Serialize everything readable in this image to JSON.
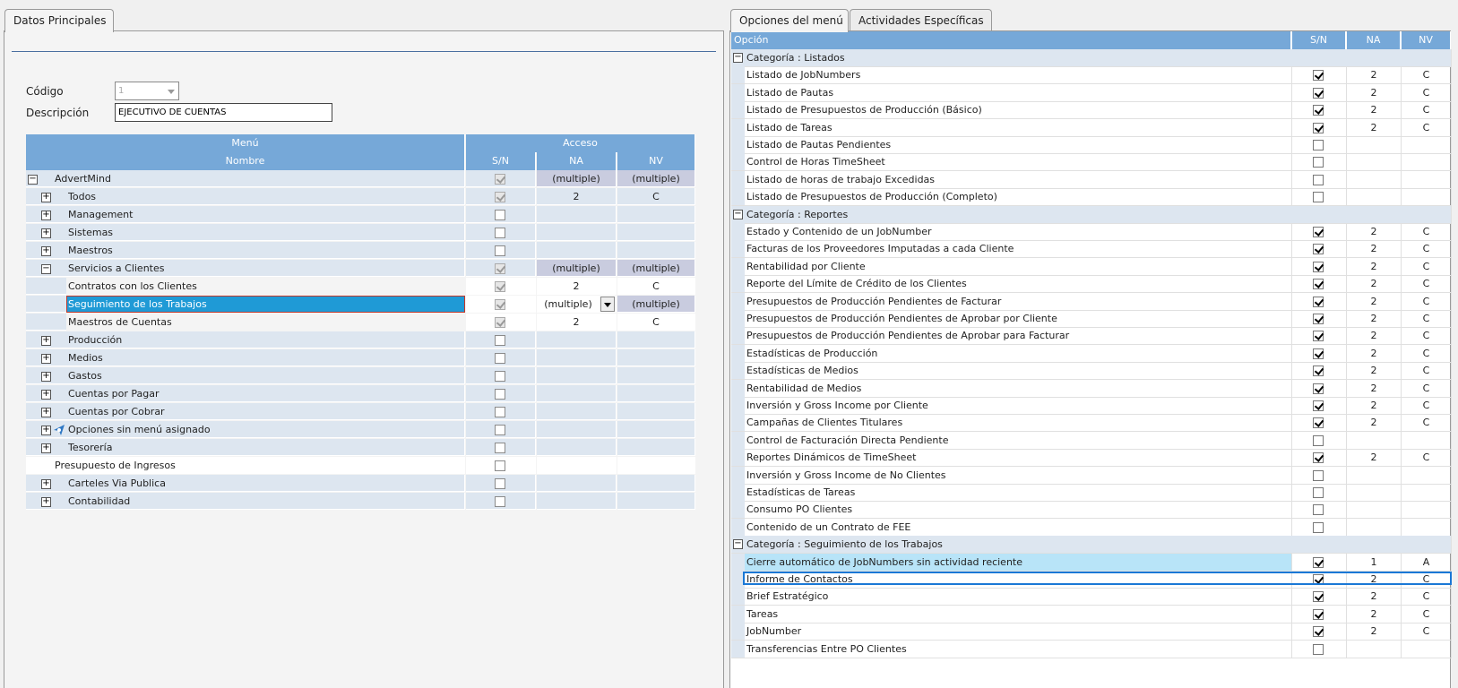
{
  "left_tabs": [
    {
      "label": "Datos Principales"
    }
  ],
  "right_tabs": [
    {
      "label": "Opciones del menú"
    },
    {
      "label": "Actividades Específicas"
    }
  ],
  "form": {
    "codigo_label": "Código",
    "codigo_value": "1",
    "descripcion_label": "Descripción",
    "descripcion_value": "EJECUTIVO DE CUENTAS"
  },
  "menu_grid": {
    "header_menu": "Menú",
    "header_acceso": "Acceso",
    "col_nombre": "Nombre",
    "col_sn": "S/N",
    "col_na": "NA",
    "col_nv": "NV",
    "rows": [
      {
        "name": "AdvertMind",
        "level": 0,
        "exp": "−",
        "sn": "disabled",
        "na": "(multiple)",
        "nv": "(multiple)"
      },
      {
        "name": "Todos",
        "level": 1,
        "exp": "+",
        "sn": "disabled",
        "na": "2",
        "nv": "C"
      },
      {
        "name": "Management",
        "level": 1,
        "exp": "+",
        "sn": "empty",
        "na": "",
        "nv": ""
      },
      {
        "name": "Sistemas",
        "level": 1,
        "exp": "+",
        "sn": "empty",
        "na": "",
        "nv": ""
      },
      {
        "name": "Maestros",
        "level": 1,
        "exp": "+",
        "sn": "empty",
        "na": "",
        "nv": ""
      },
      {
        "name": "Servicios a Clientes",
        "level": 1,
        "exp": "−",
        "sn": "disabled",
        "na": "(multiple)",
        "nv": "(multiple)"
      },
      {
        "name": "Contratos con los Clientes",
        "level": 2,
        "exp": "",
        "sn": "disabled",
        "na": "2",
        "nv": "C"
      },
      {
        "name": "Seguimiento de los Trabajos",
        "level": 2,
        "exp": "",
        "sn": "disabled",
        "na": "(multiple)",
        "nv": "(multiple)",
        "selected": true
      },
      {
        "name": "Maestros de Cuentas",
        "level": 2,
        "exp": "",
        "sn": "disabled",
        "na": "2",
        "nv": "C"
      },
      {
        "name": "Producción",
        "level": 1,
        "exp": "+",
        "sn": "empty",
        "na": "",
        "nv": ""
      },
      {
        "name": "Medios",
        "level": 1,
        "exp": "+",
        "sn": "empty",
        "na": "",
        "nv": ""
      },
      {
        "name": "Gastos",
        "level": 1,
        "exp": "+",
        "sn": "empty",
        "na": "",
        "nv": ""
      },
      {
        "name": "Cuentas por Pagar",
        "level": 1,
        "exp": "+",
        "sn": "empty",
        "na": "",
        "nv": ""
      },
      {
        "name": "Cuentas por Cobrar",
        "level": 1,
        "exp": "+",
        "sn": "empty",
        "na": "",
        "nv": ""
      },
      {
        "name": "Opciones sin menú asignado",
        "level": 1,
        "exp": "+",
        "sn": "empty",
        "na": "",
        "nv": "",
        "icon": "pin-icon"
      },
      {
        "name": "Tesorería",
        "level": 1,
        "exp": "+",
        "sn": "empty",
        "na": "",
        "nv": ""
      },
      {
        "name": "Presupuesto de Ingresos",
        "level": 0,
        "exp": "",
        "sn": "empty",
        "na": "",
        "nv": "",
        "white": true
      },
      {
        "name": "Carteles Via Publica",
        "level": 1,
        "exp": "+",
        "sn": "empty",
        "na": "",
        "nv": ""
      },
      {
        "name": "Contabilidad",
        "level": 1,
        "exp": "+",
        "sn": "empty",
        "na": "",
        "nv": ""
      }
    ]
  },
  "options_grid": {
    "col_opcion": "Opción",
    "col_sn": "S/N",
    "col_na": "NA",
    "col_nv": "NV",
    "rows": [
      {
        "cat": true,
        "name": "Categoría : Listados"
      },
      {
        "name": "Listado de JobNumbers",
        "sn": true,
        "na": "2",
        "nv": "C"
      },
      {
        "name": "Listado de Pautas",
        "sn": true,
        "na": "2",
        "nv": "C"
      },
      {
        "name": "Listado de Presupuestos de Producción (Básico)",
        "sn": true,
        "na": "2",
        "nv": "C"
      },
      {
        "name": "Listado de Tareas",
        "sn": true,
        "na": "2",
        "nv": "C"
      },
      {
        "name": "Listado de Pautas Pendientes",
        "sn": false,
        "na": "",
        "nv": ""
      },
      {
        "name": "Control de Horas TimeSheet",
        "sn": false,
        "na": "",
        "nv": ""
      },
      {
        "name": "Listado de horas de trabajo Excedidas",
        "sn": false,
        "na": "",
        "nv": ""
      },
      {
        "name": "Listado de Presupuestos de Producción (Completo)",
        "sn": false,
        "na": "",
        "nv": ""
      },
      {
        "cat": true,
        "name": "Categoría : Reportes"
      },
      {
        "name": "Estado y Contenido de un JobNumber",
        "sn": true,
        "na": "2",
        "nv": "C"
      },
      {
        "name": "Facturas de los Proveedores Imputadas a cada Cliente",
        "sn": true,
        "na": "2",
        "nv": "C"
      },
      {
        "name": "Rentabilidad por Cliente",
        "sn": true,
        "na": "2",
        "nv": "C"
      },
      {
        "name": "Reporte del Límite de Crédito de los Clientes",
        "sn": true,
        "na": "2",
        "nv": "C"
      },
      {
        "name": "Presupuestos de Producción Pendientes de Facturar",
        "sn": true,
        "na": "2",
        "nv": "C"
      },
      {
        "name": "Presupuestos de Producción Pendientes de Aprobar por Cliente",
        "sn": true,
        "na": "2",
        "nv": "C"
      },
      {
        "name": "Presupuestos de Producción Pendientes de Aprobar para Facturar",
        "sn": true,
        "na": "2",
        "nv": "C"
      },
      {
        "name": "Estadísticas de Producción",
        "sn": true,
        "na": "2",
        "nv": "C"
      },
      {
        "name": "Estadísticas de Medios",
        "sn": true,
        "na": "2",
        "nv": "C"
      },
      {
        "name": "Rentabilidad de Medios",
        "sn": true,
        "na": "2",
        "nv": "C"
      },
      {
        "name": "Inversión y Gross Income por Cliente",
        "sn": true,
        "na": "2",
        "nv": "C"
      },
      {
        "name": "Campañas de Clientes Titulares",
        "sn": true,
        "na": "2",
        "nv": "C"
      },
      {
        "name": "Control de Facturación Directa Pendiente",
        "sn": false,
        "na": "",
        "nv": ""
      },
      {
        "name": "Reportes Dinámicos de TimeSheet",
        "sn": true,
        "na": "2",
        "nv": "C"
      },
      {
        "name": "Inversión y Gross Income de No Clientes",
        "sn": false,
        "na": "",
        "nv": ""
      },
      {
        "name": "Estadísticas de Tareas",
        "sn": false,
        "na": "",
        "nv": ""
      },
      {
        "name": "Consumo PO Clientes",
        "sn": false,
        "na": "",
        "nv": ""
      },
      {
        "name": "Contenido de un Contrato de FEE",
        "sn": false,
        "na": "",
        "nv": ""
      },
      {
        "cat": true,
        "name": "Categoría : Seguimiento de los Trabajos"
      },
      {
        "name": "Cierre automático de JobNumbers sin actividad reciente",
        "sn": true,
        "na": "1",
        "nv": "A",
        "selected": true
      },
      {
        "name": "Informe de Contactos",
        "sn": true,
        "na": "2",
        "nv": "C"
      },
      {
        "name": "Brief Estratégico",
        "sn": true,
        "na": "2",
        "nv": "C"
      },
      {
        "name": "Tareas",
        "sn": true,
        "na": "2",
        "nv": "C"
      },
      {
        "name": "JobNumber",
        "sn": true,
        "na": "2",
        "nv": "C"
      },
      {
        "name": "Transferencias Entre PO Clientes",
        "sn": false,
        "na": "",
        "nv": ""
      }
    ]
  },
  "colors": {
    "header_blue": "#76a8d8",
    "selected_row": "#1f9ad6",
    "focus_border": "#1a78d6"
  }
}
